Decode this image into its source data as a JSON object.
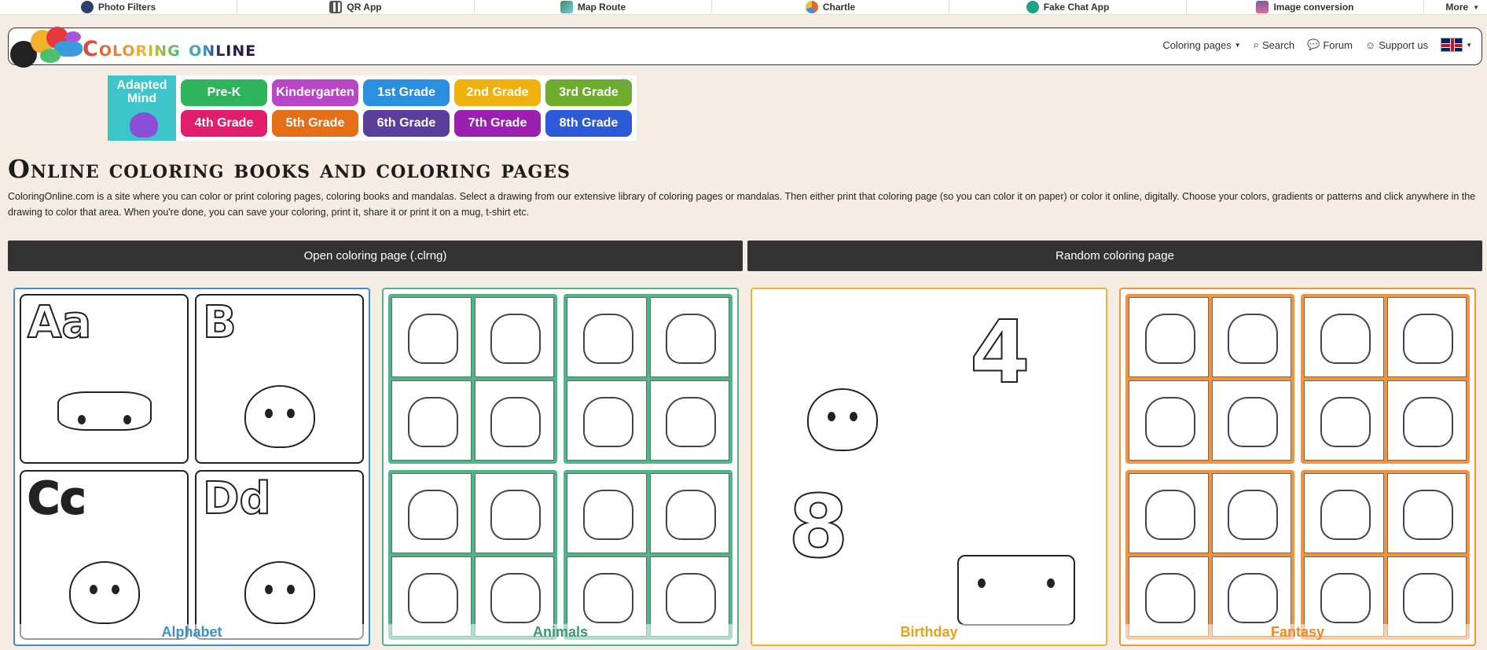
{
  "topbar": {
    "items": [
      {
        "label": "Photo Filters",
        "icon": "camera-icon",
        "color": "#2a3f6a"
      },
      {
        "label": "QR App",
        "icon": "qr-code-icon",
        "color": "#555555"
      },
      {
        "label": "Map Route",
        "icon": "map-icon",
        "color": "#3a8f5a"
      },
      {
        "label": "Chartle",
        "icon": "chart-icon",
        "color": "#e06a3a"
      },
      {
        "label": "Fake Chat App",
        "icon": "chat-icon",
        "color": "#1aa38a"
      },
      {
        "label": "Image conversion",
        "icon": "image-icon",
        "color": "#7a5ab0"
      }
    ],
    "more_label": "More"
  },
  "header": {
    "logo_text": "Coloring online",
    "nav": {
      "coloring_pages": "Coloring pages",
      "search": "Search",
      "forum": "Forum",
      "support": "Support us"
    }
  },
  "ad": {
    "brand": "Adapted Mind",
    "grades": [
      {
        "label": "Pre-K",
        "color": "#2fb35c"
      },
      {
        "label": "Kindergarten",
        "color": "#b946c7"
      },
      {
        "label": "1st Grade",
        "color": "#2b8fe0"
      },
      {
        "label": "2nd Grade",
        "color": "#f0b10f"
      },
      {
        "label": "3rd Grade",
        "color": "#6dac2c"
      },
      {
        "label": "4th Grade",
        "color": "#e11e6c"
      },
      {
        "label": "5th Grade",
        "color": "#e56f17"
      },
      {
        "label": "6th Grade",
        "color": "#5b3d9b"
      },
      {
        "label": "7th Grade",
        "color": "#9b1fb0"
      },
      {
        "label": "8th Grade",
        "color": "#2d5ad8"
      }
    ]
  },
  "main": {
    "title": "Online coloring books and coloring pages",
    "intro": "ColoringOnline.com is a site where you can color or print coloring pages, coloring books and mandalas. Select a drawing from our extensive library of coloring pages or mandalas. Then either print that coloring page (so you can color it on paper) or color it online, digitally. Choose your colors, gradients or patterns and click anywhere in the drawing to color that area. When you're done, you can save your coloring, print it, share it or print it on a mug, t-shirt etc.",
    "open_button": "Open coloring page (.clrng)",
    "random_button": "Random coloring page"
  },
  "categories": [
    {
      "label": "Alphabet",
      "color": "#3a8fd0",
      "letters": [
        "Aa",
        "B",
        "Cc",
        "Dd"
      ]
    },
    {
      "label": "Animals",
      "color": "#4cb88a"
    },
    {
      "label": "Birthday",
      "color": "#f0b030",
      "numbers": [
        "4",
        "8"
      ]
    },
    {
      "label": "Fantasy",
      "color": "#f5933a"
    }
  ]
}
